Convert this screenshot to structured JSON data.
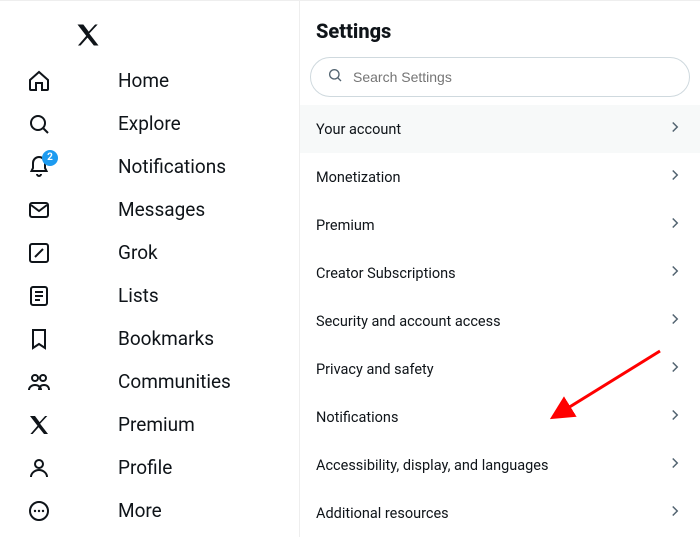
{
  "sidebar": {
    "items": [
      {
        "label": "Home"
      },
      {
        "label": "Explore"
      },
      {
        "label": "Notifications",
        "badge": "2"
      },
      {
        "label": "Messages"
      },
      {
        "label": "Grok"
      },
      {
        "label": "Lists"
      },
      {
        "label": "Bookmarks"
      },
      {
        "label": "Communities"
      },
      {
        "label": "Premium"
      },
      {
        "label": "Profile"
      },
      {
        "label": "More"
      }
    ]
  },
  "main": {
    "title": "Settings",
    "search_placeholder": "Search Settings",
    "rows": [
      {
        "label": "Your account"
      },
      {
        "label": "Monetization"
      },
      {
        "label": "Premium"
      },
      {
        "label": "Creator Subscriptions"
      },
      {
        "label": "Security and account access"
      },
      {
        "label": "Privacy and safety"
      },
      {
        "label": "Notifications"
      },
      {
        "label": "Accessibility, display, and languages"
      },
      {
        "label": "Additional resources"
      }
    ]
  }
}
